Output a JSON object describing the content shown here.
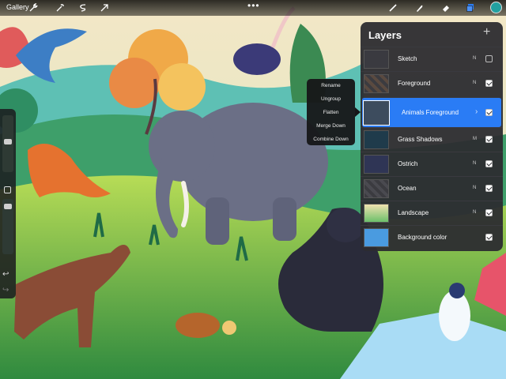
{
  "toolbar": {
    "gallery_label": "Gallery",
    "more_label": "•••",
    "left_tools": [
      "wrench-icon",
      "magic-wand-icon",
      "selection-icon",
      "transform-arrow-icon"
    ],
    "right_tools": [
      "brush-icon",
      "smudge-icon",
      "eraser-icon",
      "layers-icon"
    ],
    "current_color": "#22a0a0"
  },
  "sidebar": {
    "undo": "↩",
    "redo": "↪"
  },
  "layers_panel": {
    "title": "Layers",
    "add_label": "+",
    "layers": [
      {
        "name": "Sketch",
        "mode": "N",
        "visible": false
      },
      {
        "name": "Foreground",
        "mode": "N",
        "visible": true
      },
      {
        "name": "Animals Foreground",
        "mode": "",
        "visible": true,
        "selected": true
      },
      {
        "name": "Grass Shadows",
        "mode": "M",
        "visible": true
      },
      {
        "name": "Ostrich",
        "mode": "N",
        "visible": true
      },
      {
        "name": "Ocean",
        "mode": "N",
        "visible": true
      },
      {
        "name": "Landscape",
        "mode": "N",
        "visible": true
      },
      {
        "name": "Background color",
        "mode": "",
        "visible": true
      }
    ]
  },
  "context_menu": {
    "items": [
      "Rename",
      "Ungroup",
      "Flatten",
      "Merge Down",
      "Combine Down"
    ]
  },
  "colors": {
    "accent": "#2a7cf5",
    "panel": "#2c2c30",
    "background_color_layer": "#4a9be0"
  }
}
